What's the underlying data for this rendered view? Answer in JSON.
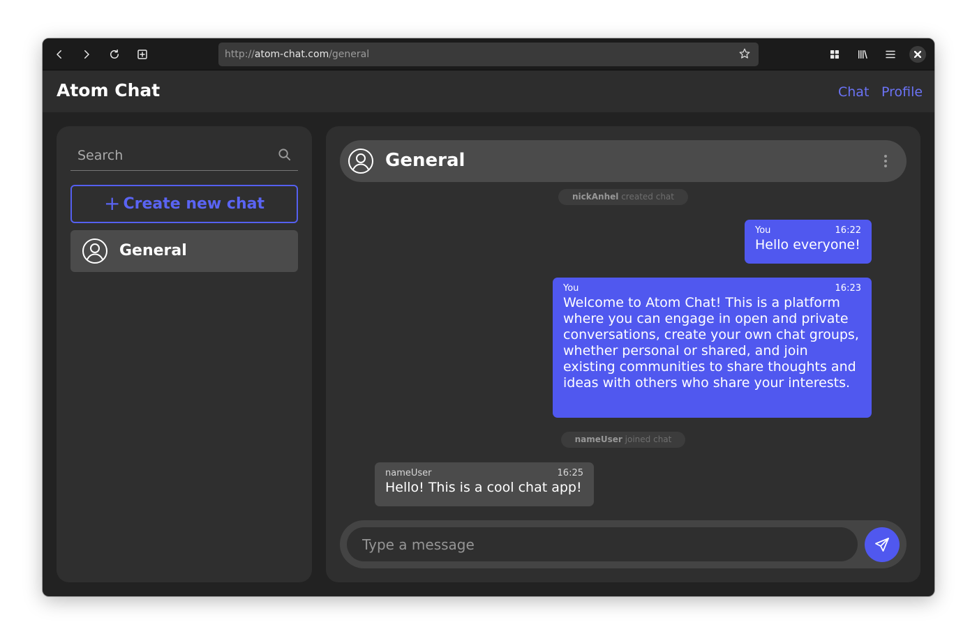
{
  "browser": {
    "url_scheme": "http://",
    "url_host": "atom-chat.com",
    "url_path": "/general",
    "icons": [
      "back-icon",
      "forward-icon",
      "reload-icon",
      "new-tab-icon",
      "bookmark-star-icon",
      "extensions-grid-icon",
      "library-icon",
      "menu-icon",
      "close-icon"
    ]
  },
  "app": {
    "title": "Atom Chat",
    "nav": [
      {
        "label": "Chat"
      },
      {
        "label": "Profile"
      }
    ],
    "accent_color": "#5058ef"
  },
  "sidebar": {
    "search_placeholder": "Search",
    "create_label": "Create new chat",
    "create_prefix": "+",
    "chats": [
      {
        "name": "General"
      }
    ]
  },
  "chat": {
    "title": "General",
    "events": [
      {
        "user": "nickAnhel",
        "action": "created chat"
      },
      {
        "user": "nameUser",
        "action": "joined chat"
      }
    ],
    "messages": [
      {
        "author": "You",
        "time": "16:22",
        "text": "Hello everyone!"
      },
      {
        "author": "You",
        "time": "16:23",
        "text": "Welcome to Atom Chat! This is a platform where you can engage in open and private conversations, create your own chat groups, whether personal or shared, and join existing communities to share thoughts and ideas with others who share your interests."
      },
      {
        "author": "nameUser",
        "time": "16:25",
        "text": "Hello! This is a cool chat app!"
      }
    ],
    "composer_placeholder": "Type a message"
  }
}
